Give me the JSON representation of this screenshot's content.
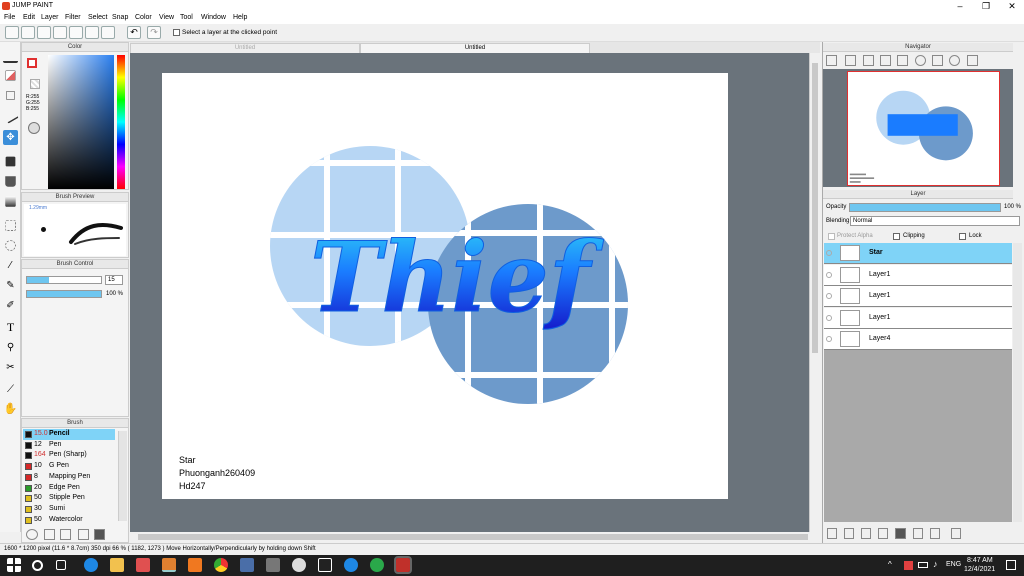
{
  "app": {
    "title": "JUMP PAINT"
  },
  "menu": [
    "File",
    "Edit",
    "Layer",
    "Filter",
    "Select",
    "Snap",
    "Color",
    "View",
    "Tool",
    "Window",
    "Help"
  ],
  "toolbar": {
    "select_layer_label": "Select a layer at the clicked point"
  },
  "tabs": [
    "Untitled",
    "Untitled"
  ],
  "color_panel": {
    "title": "Color",
    "r": "R:255",
    "g": "G:255",
    "b": "B:255"
  },
  "brush_preview": {
    "title": "Brush Preview",
    "size": "1.29mm"
  },
  "brush_control": {
    "title": "Brush Control",
    "size_value": "15",
    "opacity_value": "100 %"
  },
  "brush_panel": {
    "title": "Brush",
    "items": [
      {
        "size": "15.0",
        "name": "Pencil",
        "color": "#111111"
      },
      {
        "size": "12",
        "name": "Pen",
        "color": "#111111"
      },
      {
        "size": "164",
        "name": "Pen (Sharp)",
        "color": "#111111"
      },
      {
        "size": "10",
        "name": "G Pen",
        "color": "#d62828"
      },
      {
        "size": "8",
        "name": "Mapping Pen",
        "color": "#d62828"
      },
      {
        "size": "20",
        "name": "Edge Pen",
        "color": "#2a9d2a"
      },
      {
        "size": "50",
        "name": "Stipple Pen",
        "color": "#e0c020"
      },
      {
        "size": "30",
        "name": "Sumi",
        "color": "#e0c020"
      },
      {
        "size": "50",
        "name": "Watercolor",
        "color": "#e0c020"
      }
    ]
  },
  "canvas": {
    "word": "Thief",
    "caption_lines": [
      "Star",
      "Phuonganh260409",
      "Hd247"
    ]
  },
  "navigator": {
    "title": "Navigator"
  },
  "layer_panel": {
    "title": "Layer",
    "opacity_label": "Opacity",
    "opacity_value": "100 %",
    "blending_label": "Blending",
    "blending_value": "Normal",
    "protect_alpha": "Protect Alpha",
    "clipping": "Clipping",
    "lock": "Lock",
    "layers": [
      {
        "name": "Star",
        "selected": true
      },
      {
        "name": "Layer1",
        "selected": false
      },
      {
        "name": "Layer1",
        "selected": false
      },
      {
        "name": "Layer1",
        "selected": false
      },
      {
        "name": "Layer4",
        "selected": false
      }
    ]
  },
  "status": {
    "text": "1600 * 1200 pixel  (11.6 * 8.7cm)  350 dpi  66 %  ( 1182, 1273 )  Move Horizontally/Perpendicularly by holding down Shift"
  },
  "taskbar": {
    "time": "8:47 AM",
    "date": "12/4/2021",
    "lang": "ENG"
  },
  "colors": {
    "accent": "#7fd3f7",
    "light_circle": "#b7d6f4",
    "dark_circle": "#6d9acb"
  }
}
